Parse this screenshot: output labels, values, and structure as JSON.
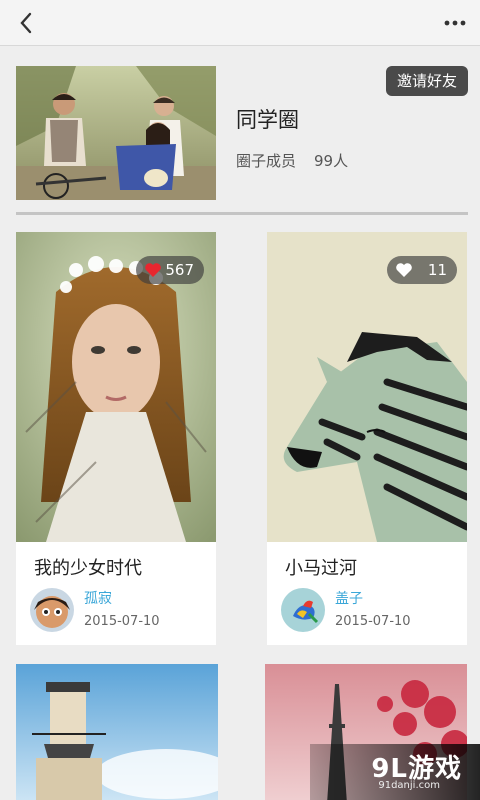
{
  "nav": {
    "back_icon": "back-chevron-icon",
    "more_icon": "more-dots-icon"
  },
  "circle": {
    "title": "同学圈",
    "member_label": "圈子成员",
    "member_count": "99人",
    "invite_label": "邀请好友"
  },
  "cards": [
    {
      "title": "我的少女时代",
      "likes": "567",
      "liked": true,
      "author": "孤寂",
      "date": "2015-07-10"
    },
    {
      "title": "小马过河",
      "likes": "11",
      "liked": false,
      "author": "盖子",
      "date": "2015-07-10"
    }
  ],
  "watermark": {
    "logo": "9L游戏",
    "url": "91danji.com"
  },
  "colors": {
    "accent": "#3ba7d8",
    "like_red": "#e8262f",
    "badge_bg": "#4a4a4a"
  }
}
